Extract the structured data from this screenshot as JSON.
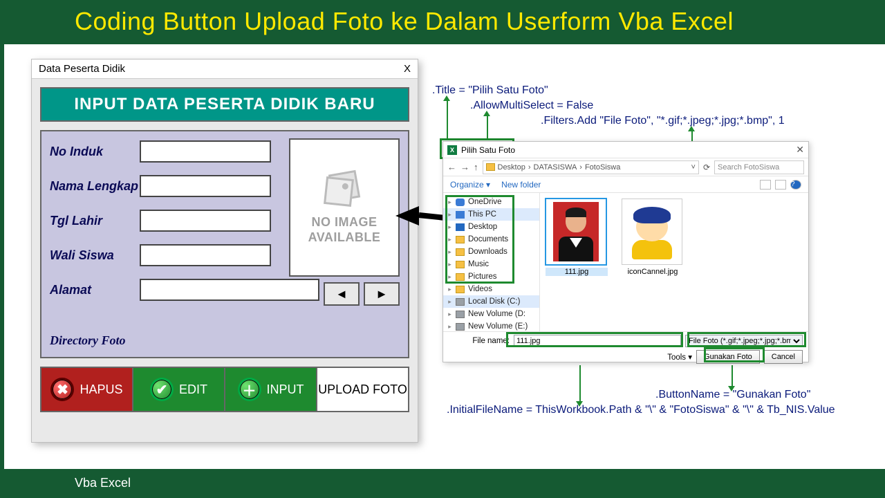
{
  "page": {
    "title": "Coding Button Upload Foto ke Dalam Userform  Vba Excel",
    "footer": "Vba Excel"
  },
  "userform": {
    "window_title": "Data Peserta Didik",
    "banner": "INPUT DATA PESERTA DIDIK BARU",
    "fields": {
      "no_induk": {
        "label": "No Induk",
        "value": ""
      },
      "nama": {
        "label": "Nama Lengkap",
        "value": ""
      },
      "tgl_lahir": {
        "label": "Tgl Lahir",
        "value": ""
      },
      "wali": {
        "label": "Wali Siswa",
        "value": ""
      },
      "alamat": {
        "label": "Alamat",
        "value": ""
      },
      "dir": {
        "label": "Directory Foto",
        "value": ""
      }
    },
    "no_image": "NO IMAGE AVAILABLE",
    "buttons": {
      "hapus": "HAPUS",
      "edit": "EDIT",
      "input": "INPUT",
      "upload": "UPLOAD FOTO"
    }
  },
  "annotations": {
    "title": ".Title = \"Pilih Satu Foto\"",
    "multi": ".AllowMultiSelect = False",
    "filter": ".Filters.Add \"File Foto\", \"*.gif;*.jpeg;*.jpg;*.bmp\", 1",
    "btnname": ".ButtonName = \"Gunakan Foto\"",
    "initfn": ".InitialFileName = ThisWorkbook.Path & \"\\\" & \"FotoSiswa\" & \"\\\" & Tb_NIS.Value"
  },
  "dialog": {
    "title": "Pilih Satu Foto",
    "breadcrumb": [
      "Desktop",
      "DATASISWA",
      "FotoSiswa"
    ],
    "search_placeholder": "Search FotoSiswa",
    "toolbar": {
      "organize": "Organize",
      "newfolder": "New folder"
    },
    "tree": [
      {
        "label": "OneDrive",
        "icon": "cloud"
      },
      {
        "label": "This PC",
        "icon": "pc",
        "sel": true
      },
      {
        "label": "Desktop",
        "icon": "dsk"
      },
      {
        "label": "Documents",
        "icon": "fld"
      },
      {
        "label": "Downloads",
        "icon": "fld"
      },
      {
        "label": "Music",
        "icon": "fld"
      },
      {
        "label": "Pictures",
        "icon": "fld"
      },
      {
        "label": "Videos",
        "icon": "fld"
      },
      {
        "label": "Local Disk (C:)",
        "icon": "drv",
        "sel": true
      },
      {
        "label": "New Volume (D:",
        "icon": "drv"
      },
      {
        "label": "New Volume (E:)",
        "icon": "drv"
      }
    ],
    "files": [
      {
        "name": "111.jpg",
        "kind": "portrait",
        "selected": true
      },
      {
        "name": "iconCannel.jpg",
        "kind": "cartoon"
      }
    ],
    "footer": {
      "filename_label": "File name:",
      "filename_value": "111.jpg",
      "filter_value": "File Foto (*.gif;*.jpeg;*.jpg;*.bmp)",
      "tools": "Tools",
      "open": "Gunakan Foto",
      "cancel": "Cancel"
    }
  }
}
